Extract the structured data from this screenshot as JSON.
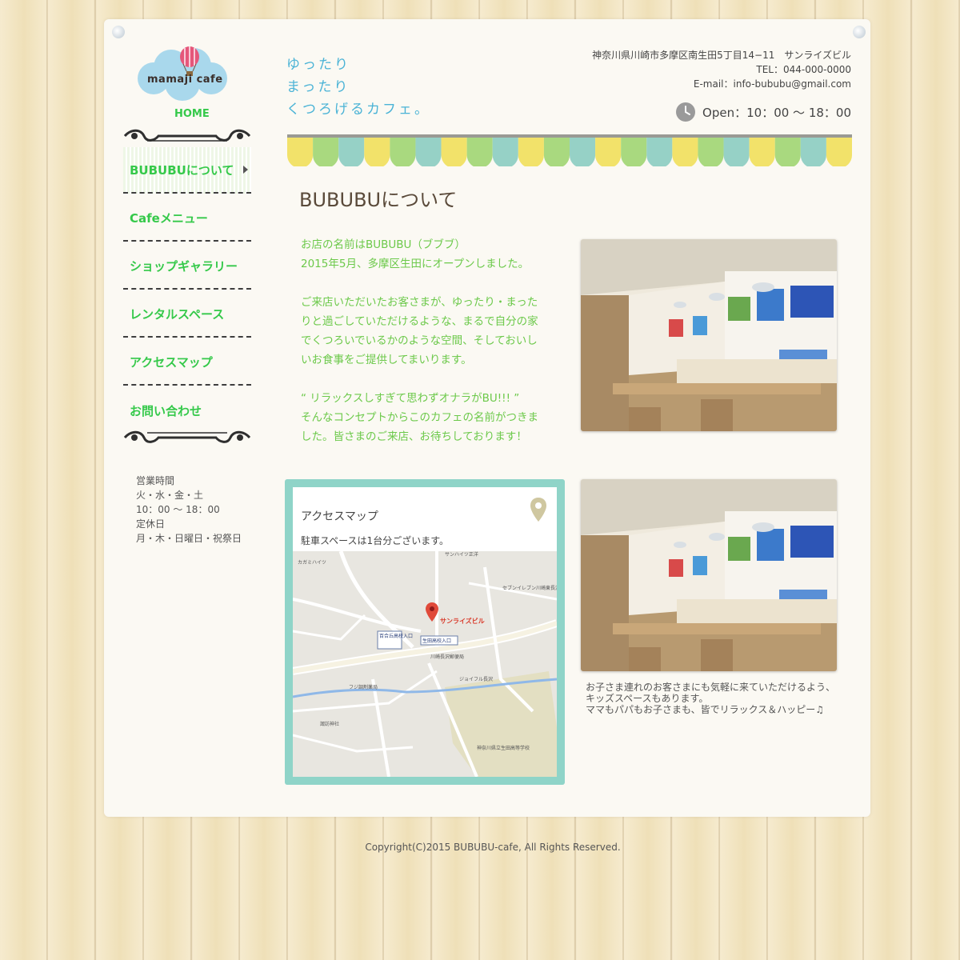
{
  "logo": {
    "text": "mamaji cafe"
  },
  "nav": {
    "home": "HOME",
    "items": [
      {
        "label": "BUBUBUについて"
      },
      {
        "label": "Cafeメニュー"
      },
      {
        "label": "ショップギャラリー"
      },
      {
        "label": "レンタルスペース"
      },
      {
        "label": "アクセスマップ"
      },
      {
        "label": "お問い合わせ"
      }
    ]
  },
  "hours": {
    "heading": "営業時間",
    "days": "火・水・金・土",
    "time": "10：00 〜 18：00",
    "closed_heading": "定休日",
    "closed_days": "月・木・日曜日・祝祭日"
  },
  "tagline": [
    "ゆったり",
    "まったり",
    "くつろげるカフェ。"
  ],
  "contact": {
    "address": "神奈川県川崎市多摩区南生田5丁目14−11　サンライズビル",
    "tel": "TEL：044-000-0000",
    "email": "E-mail：info-bububu@gmail.com",
    "open": "Open：10：00 〜 18：00"
  },
  "about": {
    "title": "BUBUBUについて",
    "p1": [
      "お店の名前はBUBUBU（ブブブ）",
      "2015年5月、多摩区生田にオープンしました。"
    ],
    "p2": [
      "ご来店いただいたお客さまが、ゆったり・まった",
      "りと過ごしていただけるような、まるで自分の家",
      "でくつろいでいるかのような空間、そしておいし",
      "いお食事をご提供してまいります。"
    ],
    "p3": [
      "“ リラックスしすぎて思わずオナラがBU!!! ”",
      "そんなコンセプトからこのカフェの名前がつきま",
      "した。皆さまのご来店、お待ちしております！"
    ]
  },
  "access": {
    "title": "アクセスマップ",
    "parking": "駐車スペースは1台分ございます。",
    "map_labels": {
      "building": "サンライズビル",
      "school_entry": "生田高校入口",
      "school": "神奈川県立生田高等学校",
      "post": "川崎長沢郵便局",
      "sunhights": "サンハイツ正洋",
      "kagami": "カガミハイツ",
      "seven": "セブンイレブン川崎東長沢店",
      "shrine": "諏訪神社",
      "fuji": "フジ調剤薬局",
      "jaiful": "ジョイフル長沢",
      "yurigaoka": "百合丘高校入口"
    }
  },
  "caption": [
    "お子さま連れのお客さまにも気軽に来ていただけるよう、",
    "キッズスペースもあります。",
    "ママもパパもお子さまも、皆でリラックス＆ハッピー♫"
  ],
  "footer": {
    "copyright": "Copyright(C)2015 BUBUBU-cafe, All Rights Reserved."
  },
  "colors": {
    "green": "#35c94a",
    "tagline_blue": "#4ab3d6",
    "access_frame": "#8fd4c8"
  }
}
